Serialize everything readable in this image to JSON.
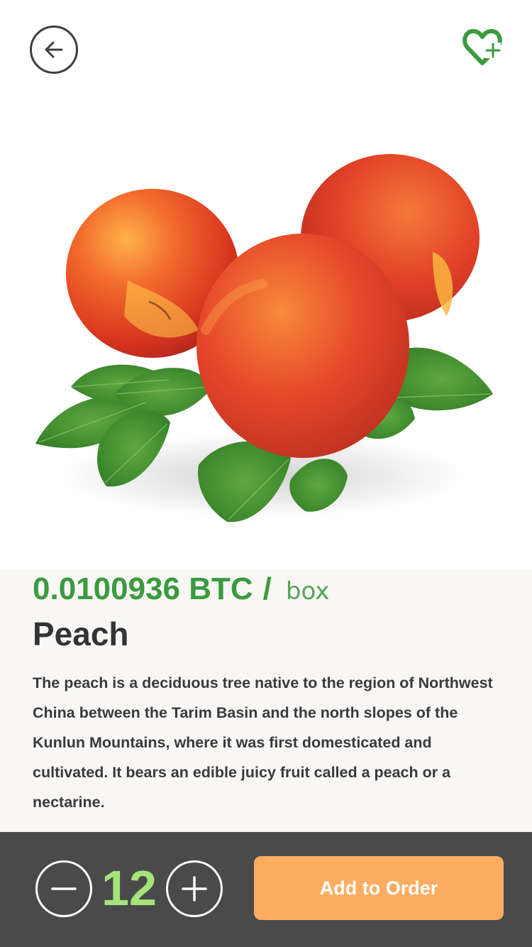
{
  "header": {
    "back_icon": "arrow-left-icon",
    "favorite_icon": "heart-plus-icon",
    "favorite_color": "#3b9a3f"
  },
  "product": {
    "image_icon": "peaches-with-leaves-image",
    "price": "0.0100936 BTC",
    "price_separator": "/",
    "unit": "box",
    "name": "Peach",
    "description": "The peach is a deciduous tree native to the region of Northwest China between the Tarim Basin and the north slopes of the Kunlun Mountains, where it was first domesticated and cultivated. It bears an edible juicy fruit called a peach or a nectarine.",
    "price_color": "#3b9a3f"
  },
  "order_bar": {
    "minus_icon": "minus-icon",
    "plus_icon": "plus-icon",
    "quantity": "12",
    "add_label": "Add to Order",
    "bar_color": "#4a4a4a",
    "quantity_color": "#a6e37a",
    "button_color": "#fdad62"
  }
}
